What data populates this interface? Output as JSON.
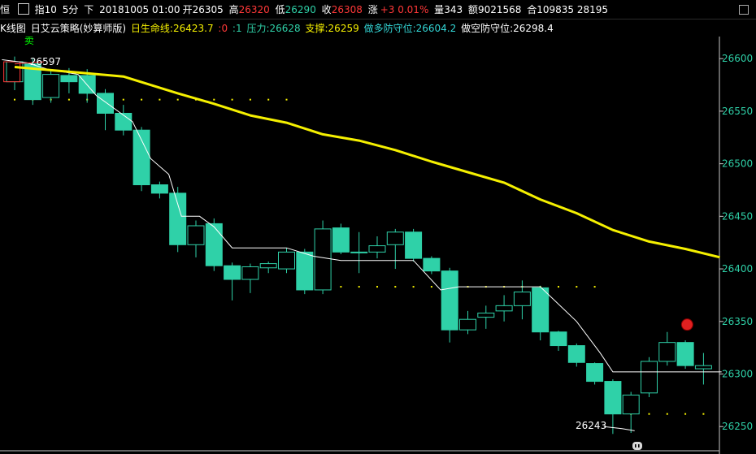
{
  "header": {
    "tab": "恒",
    "symbol": "指10",
    "period": "5分",
    "direction": "下",
    "datetime": "20181005 01:00",
    "open_label": "开",
    "open": "26305",
    "high_label": "高",
    "high": "26320",
    "low_label": "低",
    "low": "26290",
    "close_label": "收",
    "close": "26308",
    "change_label": "涨",
    "change": "+3 0.01%",
    "volume_label": "量",
    "volume": "343",
    "amount_label": "额",
    "amount": "9021568",
    "oi_label": "合",
    "oi": "109835 28195"
  },
  "indicator_bar": {
    "kline": "K线图",
    "strategy": "日艾云策略(妙算师版)",
    "life_line_label": "日生命线:",
    "life_line": "26423.7",
    "extra1": ":0",
    "extra2": ":1",
    "pressure_label": "压力:",
    "pressure": "26628",
    "support_label": "支撑:",
    "support": "26259",
    "long_defense_label": "做多防守位:",
    "long_defense": "26604.2",
    "short_defense_label": "做空防守位:",
    "short_defense": "26298.4"
  },
  "colors": {
    "up": "#000000",
    "up_edge": "#2fd1a8",
    "down": "#2fd1a8",
    "yellow": "#f5f000",
    "axis_text": "#2fd1a8",
    "red": "#ff3838",
    "white": "#ffffff",
    "cyan": "#33d6d6",
    "sell_text": "#00ff00"
  },
  "chart_data": {
    "type": "candlestick",
    "ylim": [
      26227,
      26621
    ],
    "y_ticks": [
      26250,
      26300,
      26350,
      26400,
      26450,
      26500,
      26550,
      26600
    ],
    "candles": [
      {
        "o": 26578,
        "c": 26597,
        "h": 26602,
        "l": 26570
      },
      {
        "o": 26595,
        "c": 26561,
        "h": 26600,
        "l": 26556
      },
      {
        "o": 26563,
        "c": 26585,
        "h": 26590,
        "l": 26558
      },
      {
        "o": 26584,
        "c": 26578,
        "h": 26591,
        "l": 26567
      },
      {
        "o": 26584,
        "c": 26567,
        "h": 26590,
        "l": 26558
      },
      {
        "o": 26567,
        "c": 26548,
        "h": 26571,
        "l": 26532
      },
      {
        "o": 26548,
        "c": 26532,
        "h": 26556,
        "l": 26527
      },
      {
        "o": 26532,
        "c": 26480,
        "h": 26535,
        "l": 26474
      },
      {
        "o": 26480,
        "c": 26472,
        "h": 26483,
        "l": 26467
      },
      {
        "o": 26472,
        "c": 26423,
        "h": 26478,
        "l": 26416
      },
      {
        "o": 26423,
        "c": 26441,
        "h": 26446,
        "l": 26411
      },
      {
        "o": 26443,
        "c": 26403,
        "h": 26448,
        "l": 26398
      },
      {
        "o": 26403,
        "c": 26390,
        "h": 26406,
        "l": 26370
      },
      {
        "o": 26390,
        "c": 26402,
        "h": 26405,
        "l": 26377
      },
      {
        "o": 26401,
        "c": 26405,
        "h": 26407,
        "l": 26396
      },
      {
        "o": 26400,
        "c": 26416,
        "h": 26420,
        "l": 26396
      },
      {
        "o": 26416,
        "c": 26380,
        "h": 26419,
        "l": 26376
      },
      {
        "o": 26380,
        "c": 26438,
        "h": 26446,
        "l": 26376
      },
      {
        "o": 26439,
        "c": 26416,
        "h": 26443,
        "l": 26414
      },
      {
        "o": 26416,
        "c": 26416,
        "h": 26435,
        "l": 26396
      },
      {
        "o": 26416,
        "c": 26422,
        "h": 26431,
        "l": 26410
      },
      {
        "o": 26423,
        "c": 26435,
        "h": 26438,
        "l": 26400
      },
      {
        "o": 26435,
        "c": 26410,
        "h": 26438,
        "l": 26407
      },
      {
        "o": 26410,
        "c": 26398,
        "h": 26412,
        "l": 26395
      },
      {
        "o": 26398,
        "c": 26342,
        "h": 26401,
        "l": 26330
      },
      {
        "o": 26342,
        "c": 26352,
        "h": 26360,
        "l": 26338
      },
      {
        "o": 26354,
        "c": 26358,
        "h": 26365,
        "l": 26343
      },
      {
        "o": 26360,
        "c": 26365,
        "h": 26375,
        "l": 26350
      },
      {
        "o": 26365,
        "c": 26378,
        "h": 26389,
        "l": 26352
      },
      {
        "o": 26382,
        "c": 26340,
        "h": 26384,
        "l": 26332
      },
      {
        "o": 26340,
        "c": 26327,
        "h": 26341,
        "l": 26322
      },
      {
        "o": 26327,
        "c": 26311,
        "h": 26329,
        "l": 26307
      },
      {
        "o": 26310,
        "c": 26293,
        "h": 26311,
        "l": 26290
      },
      {
        "o": 26293,
        "c": 26262,
        "h": 26295,
        "l": 26243
      },
      {
        "o": 26262,
        "c": 26280,
        "h": 26283,
        "l": 26244
      },
      {
        "o": 26282,
        "c": 26312,
        "h": 26316,
        "l": 26278
      },
      {
        "o": 26312,
        "c": 26330,
        "h": 26340,
        "l": 26308
      },
      {
        "o": 26330,
        "c": 26308,
        "h": 26332,
        "l": 26305
      },
      {
        "o": 26305,
        "c": 26308,
        "h": 26320,
        "l": 26290
      }
    ],
    "life_line": [
      [
        0,
        26592
      ],
      [
        4,
        26586
      ],
      [
        6,
        26583
      ],
      [
        9,
        26567
      ],
      [
        11,
        26557
      ],
      [
        13,
        26546
      ],
      [
        15,
        26539
      ],
      [
        17,
        26528
      ],
      [
        19,
        26522
      ],
      [
        21,
        26513
      ],
      [
        23,
        26502
      ],
      [
        25,
        26492
      ],
      [
        27,
        26482
      ],
      [
        29,
        26466
      ],
      [
        31,
        26453
      ],
      [
        33,
        26437
      ],
      [
        35,
        26426
      ],
      [
        37,
        26419
      ],
      [
        38.9,
        26411
      ]
    ],
    "white_line": [
      [
        -0.7,
        26599
      ],
      [
        0.7,
        26596
      ],
      [
        1.8,
        26590
      ],
      [
        3.5,
        26585
      ],
      [
        4.5,
        26565
      ],
      [
        6.5,
        26540
      ],
      [
        7.5,
        26505
      ],
      [
        8.5,
        26490
      ],
      [
        9.2,
        26450
      ],
      [
        10.2,
        26450
      ],
      [
        11,
        26440
      ],
      [
        12,
        26420
      ],
      [
        15,
        26420
      ],
      [
        16.5,
        26412
      ],
      [
        18,
        26408
      ],
      [
        22,
        26408
      ],
      [
        23.5,
        26380
      ],
      [
        24.5,
        26383
      ],
      [
        28,
        26383
      ],
      [
        29,
        26383
      ],
      [
        31,
        26350
      ],
      [
        32.3,
        26320
      ],
      [
        33,
        26302
      ],
      [
        33.5,
        26302
      ],
      [
        39,
        26302
      ]
    ],
    "low_trace": [
      [
        32.5,
        26250
      ],
      [
        33.5,
        26248
      ],
      [
        34.2,
        26246
      ]
    ],
    "pivot_line": [
      [
        0,
        26595
      ],
      [
        1.6,
        26597
      ]
    ],
    "dot_rows": [
      {
        "y": 26561,
        "from": 0,
        "to": 15,
        "color": "#f5f000"
      },
      {
        "y": 26383,
        "from": 17,
        "to": 32,
        "color": "#f5f000"
      },
      {
        "y": 26262,
        "from": 34,
        "to": 38,
        "color": "#f5f000"
      }
    ],
    "annotations": [
      {
        "text": "26597",
        "i": 1.7,
        "y": 26597
      },
      {
        "text": "26243",
        "i": 31.8,
        "y": 26251
      }
    ],
    "sell_signal": {
      "text": "卖",
      "i": 0.8,
      "y": 26617
    },
    "red_marker": {
      "i": 37.1,
      "y": 26347
    },
    "red_box": {
      "i": -0.15,
      "o": 26597,
      "c": 26578
    }
  }
}
